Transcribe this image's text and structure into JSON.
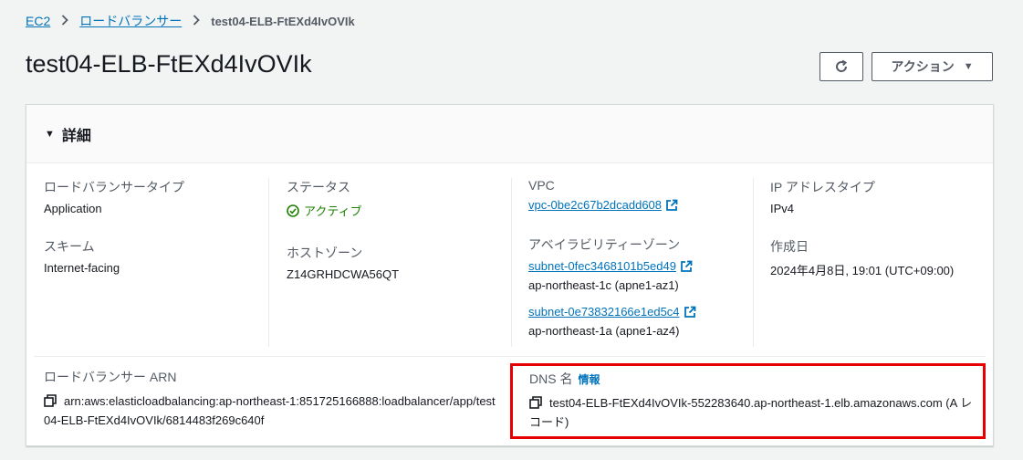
{
  "breadcrumb": {
    "items": [
      "EC2",
      "ロードバランサー"
    ],
    "current": "test04-ELB-FtEXd4IvOVIk"
  },
  "page": {
    "title": "test04-ELB-FtEXd4IvOVIk"
  },
  "toolbar": {
    "actions_label": "アクション"
  },
  "details": {
    "header": "詳細",
    "lb_type_label": "ロードバランサータイプ",
    "lb_type_value": "Application",
    "scheme_label": "スキーム",
    "scheme_value": "Internet-facing",
    "status_label": "ステータス",
    "status_value": "アクティブ",
    "hosted_zone_label": "ホストゾーン",
    "hosted_zone_value": "Z14GRHDCWA56QT",
    "vpc_label": "VPC",
    "vpc_value": "vpc-0be2c67b2dcadd608",
    "az_label": "アベイラビリティーゾーン",
    "subnet1": "subnet-0fec3468101b5ed49",
    "subnet1_az": "ap-northeast-1c (apne1-az1)",
    "subnet2": "subnet-0e73832166e1ed5c4",
    "subnet2_az": "ap-northeast-1a (apne1-az4)",
    "ip_type_label": "IP アドレスタイプ",
    "ip_type_value": "IPv4",
    "created_label": "作成日",
    "created_value": "2024年4月8日, 19:01 (UTC+09:00)",
    "arn_label": "ロードバランサー ARN",
    "arn_value": "arn:aws:elasticloadbalancing:ap-northeast-1:851725166888:loadbalancer/app/test04-ELB-FtEXd4IvOVIk/6814483f269c640f",
    "dns_label": "DNS 名",
    "dns_info": "情報",
    "dns_value": "test04-ELB-FtEXd4IvOVIk-552283640.ap-northeast-1.elb.amazonaws.com (A レコード)"
  },
  "colors": {
    "link": "#0073bb",
    "success": "#1d8102",
    "highlight": "#e60000"
  }
}
